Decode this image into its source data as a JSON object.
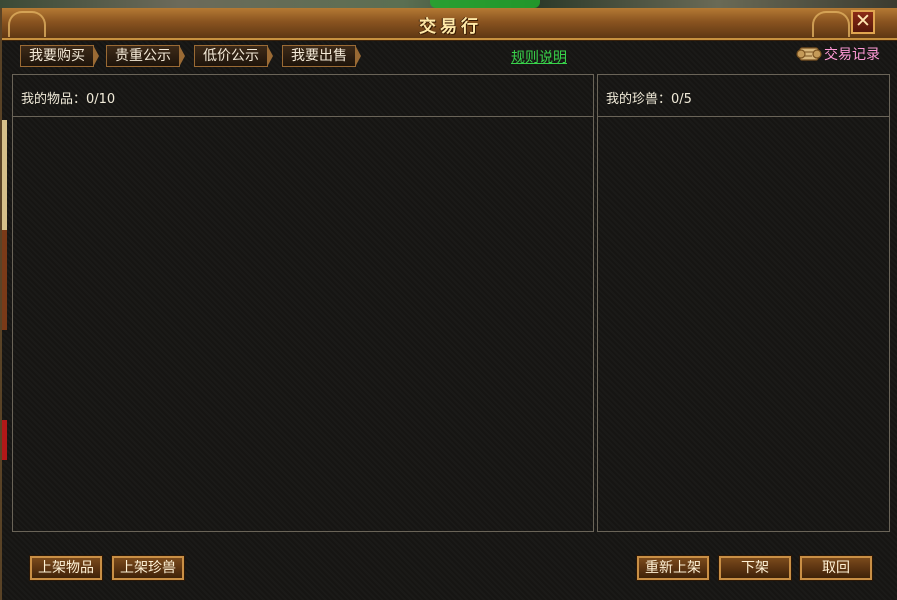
{
  "window": {
    "title": "交易行",
    "close_label": "✕"
  },
  "tabs": [
    {
      "label": "我要购买"
    },
    {
      "label": "贵重公示"
    },
    {
      "label": "低价公示"
    },
    {
      "label": "我要出售"
    }
  ],
  "rules_link": "规则说明",
  "records": {
    "label": "交易记录",
    "icon": "scroll-icon"
  },
  "items_panel": {
    "label": "我的物品：0/10"
  },
  "pets_panel": {
    "label": "我的珍兽：0/5"
  },
  "buttons": {
    "list_item": "上架物品",
    "list_pet": "上架珍兽",
    "relist": "重新上架",
    "delist": "下架",
    "retrieve": "取回"
  },
  "colors": {
    "title_bar": "#8a5420",
    "link": "#38d24a",
    "records": "#ff9ad6",
    "panel_border": "#6a6458"
  }
}
